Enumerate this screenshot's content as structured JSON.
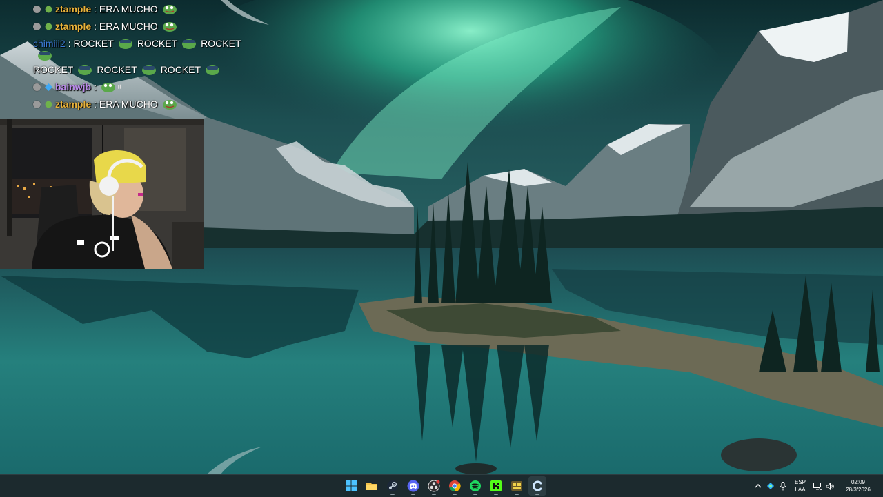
{
  "chat": {
    "messages": [
      {
        "user": "ztample",
        "user_color": "#e8b23a",
        "text": "ERA MUCHO",
        "badges": [
          "dot",
          "sub"
        ]
      },
      {
        "user": "ztample",
        "user_color": "#e8b23a",
        "text": "ERA MUCHO",
        "badges": [
          "dot",
          "sub"
        ]
      },
      {
        "user": "chimiii2",
        "user_color": "#3b7bd6",
        "text": "ROCKET",
        "badges": []
      },
      {
        "user": "bainwjb",
        "user_color": "#b98be8",
        "text": "",
        "badges": [
          "dot",
          "blue"
        ]
      },
      {
        "user": "ztample",
        "user_color": "#e8b23a",
        "text": "ERA MUCHO",
        "badges": [
          "dot",
          "sub"
        ]
      }
    ],
    "separator": ":",
    "rocket_word": "ROCKET"
  },
  "taskbar": {
    "apps": [
      {
        "name": "windows-start"
      },
      {
        "name": "file-explorer"
      },
      {
        "name": "steam"
      },
      {
        "name": "discord"
      },
      {
        "name": "obs"
      },
      {
        "name": "chrome"
      },
      {
        "name": "spotify"
      },
      {
        "name": "kick"
      },
      {
        "name": "streamer-tool"
      },
      {
        "name": "chatterino"
      }
    ],
    "language_top": "ESP",
    "language_bottom": "LAA",
    "time": "02:09",
    "date": "28/3/2026"
  },
  "colors": {
    "taskbar_bg": "#1c2a2e",
    "aurora": "#3fe3b3",
    "water": "#1f6a6a"
  }
}
